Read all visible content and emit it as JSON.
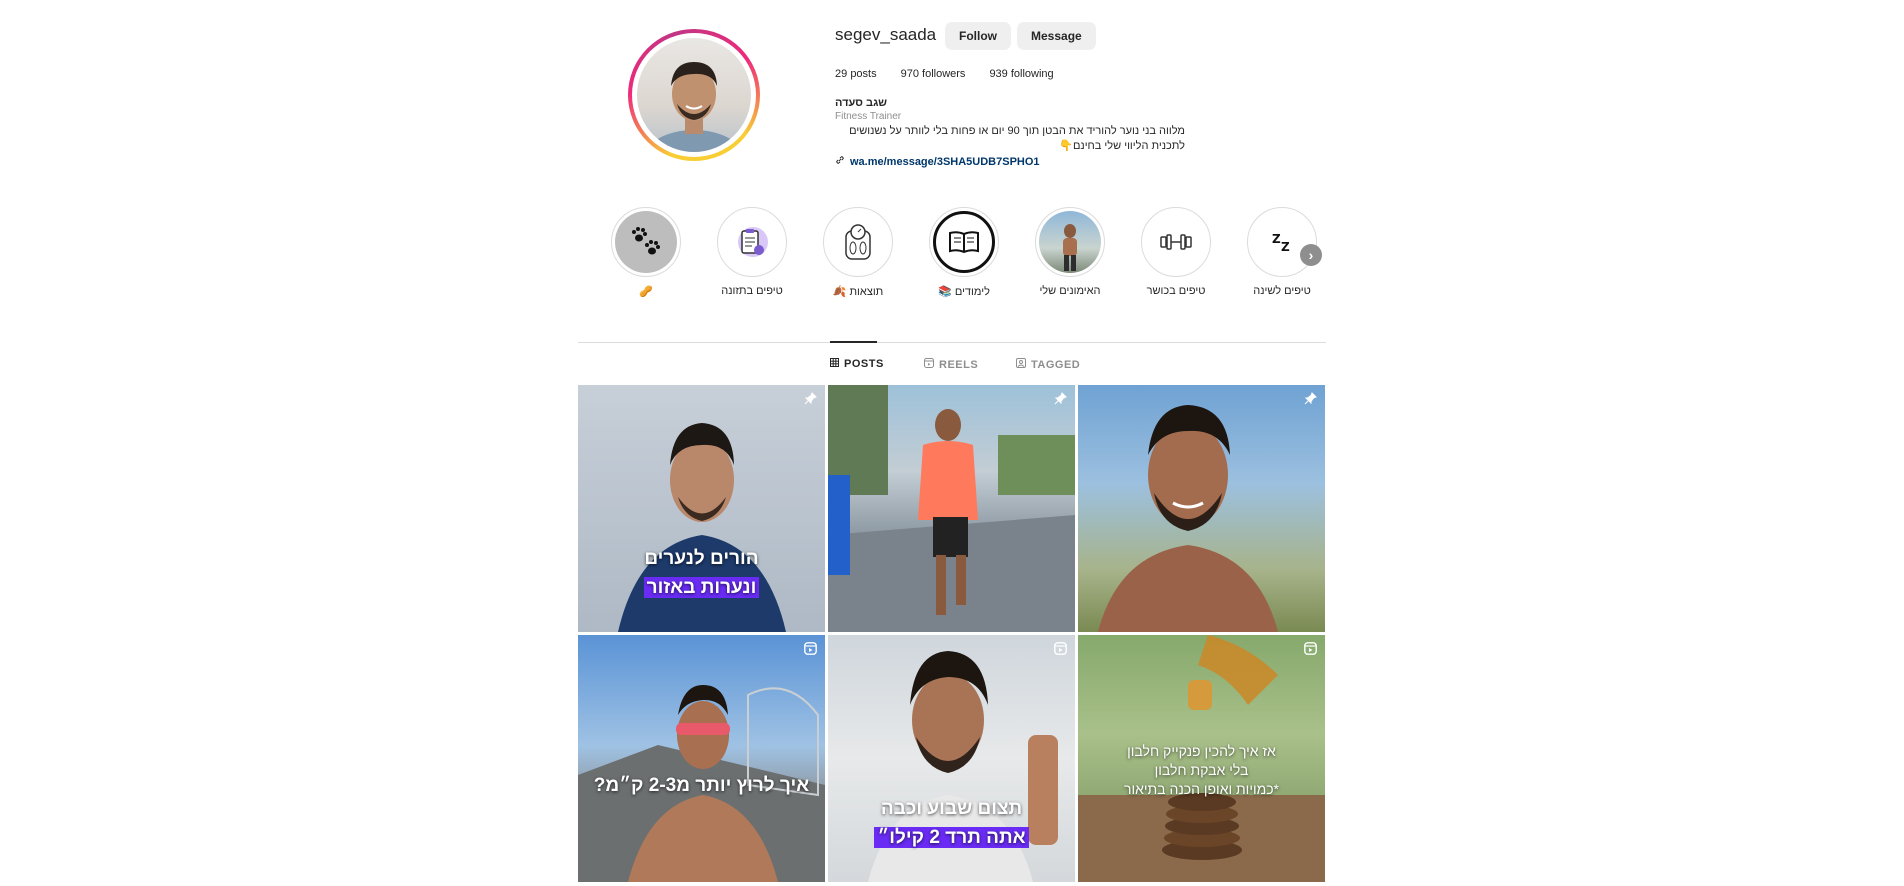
{
  "profile": {
    "username": "segev_saada",
    "follow_label": "Follow",
    "message_label": "Message",
    "posts_count": "29",
    "posts_label": "posts",
    "followers_count": "970",
    "followers_label": "followers",
    "following_count": "939",
    "following_label": "following",
    "name": "שגב סעדה",
    "category": "Fitness Trainer",
    "bio_line1": "מלווה בני נוער להוריד את הבטן תוך 90 יום או פחות בלי לוותר על נשנושים",
    "bio_line2": "לתכנית הליווי שלי בחינם👇",
    "link": "wa.me/message/3SHA5UDB7SPHO1"
  },
  "highlights": [
    {
      "label": "טיפים לשינה",
      "icon": "sleep-zz-icon"
    },
    {
      "label": "טיפים בכושר",
      "icon": "dumbbell-icon"
    },
    {
      "label": "האימונים שלי",
      "icon": "photo"
    },
    {
      "label": "לימודים 📚",
      "icon": "book-icon"
    },
    {
      "label": "תוצאות 🍂",
      "icon": "scale-icon"
    },
    {
      "label": "טיפים בתזונה",
      "icon": "clipboard-icon"
    },
    {
      "label": "🥜",
      "icon": "paw-prints-icon"
    }
  ],
  "tabs": [
    {
      "label": "POSTS",
      "icon": "grid-icon",
      "active": true
    },
    {
      "label": "REELS",
      "icon": "reels-icon",
      "active": false
    },
    {
      "label": "TAGGED",
      "icon": "tagged-icon",
      "active": false
    }
  ],
  "posts": [
    {
      "badge": "pin-icon",
      "caption_line1": "הורים לנערים",
      "caption_line2": "ונערות באזור"
    },
    {
      "badge": "pin-icon",
      "caption_line1": "",
      "caption_line2": ""
    },
    {
      "badge": "pin-icon",
      "caption_line1": "",
      "caption_line2": ""
    },
    {
      "badge": "reels-icon",
      "caption_line1": "איך לרוץ יותר מ2-3 ק״מ?",
      "caption_line2": ""
    },
    {
      "badge": "reels-icon",
      "caption_line1": "תצום שבוע וכבה",
      "caption_line2": "אתה תרד 2 קילו״"
    },
    {
      "badge": "reels-icon",
      "caption_line1": "אז איך להכין פנקייק חלבון",
      "caption_line2": "בלי אבקת חלבון",
      "caption_line3": "*כמויות ואופן הכנה בתיאור"
    }
  ],
  "colors": {
    "accent_link": "#00376b",
    "caption_highlight": "#6a2cf5"
  }
}
